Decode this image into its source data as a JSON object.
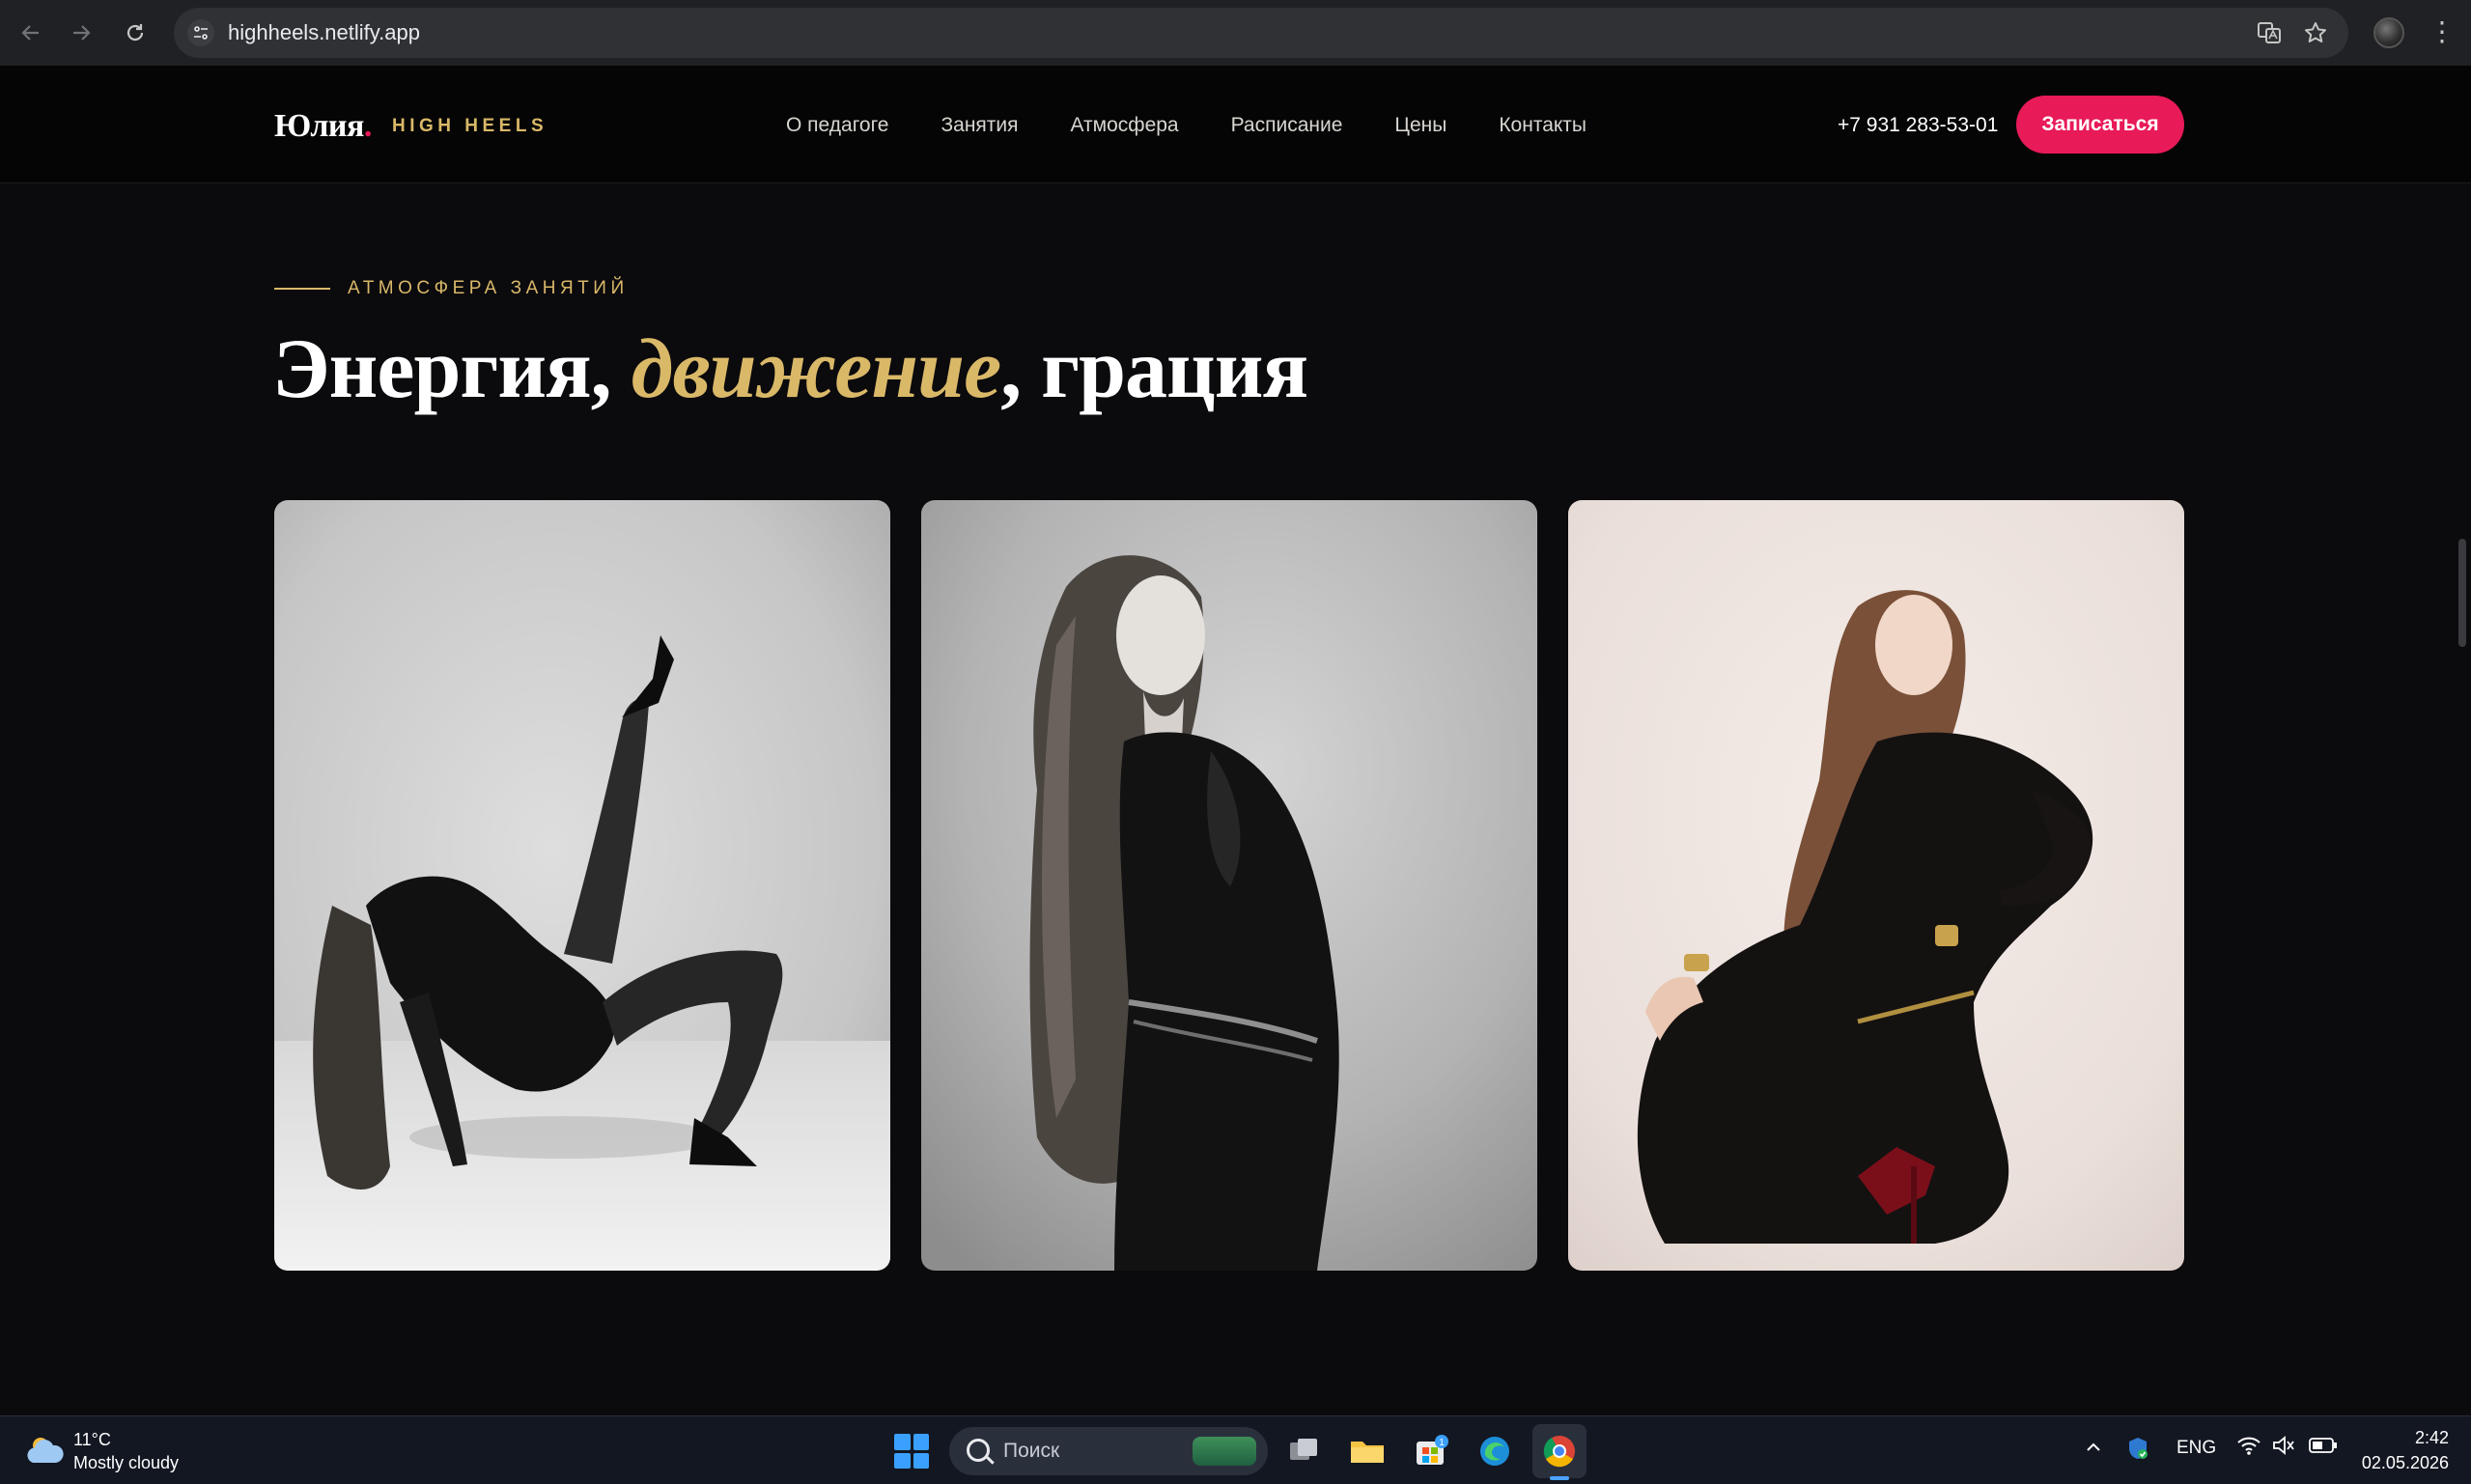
{
  "browser": {
    "url": "highheels.netlify.app",
    "icons": [
      "back-arrow-icon",
      "forward-arrow-icon",
      "reload-icon",
      "site-settings-icon",
      "translate-icon",
      "bookmark-star-icon",
      "profile-avatar",
      "menu-kebab-icon"
    ]
  },
  "header": {
    "logo_name": "Юлия",
    "logo_dot": ".",
    "logo_tag": "HIGH HEELS",
    "menu": [
      "О педагоге",
      "Занятия",
      "Атмосфера",
      "Расписание",
      "Цены",
      "Контакты"
    ],
    "phone": "+7 931 283-53-01",
    "cta_label": "Записаться",
    "accent_color": "#e81a58",
    "gold_color": "#d9b868"
  },
  "section": {
    "eyebrow": "АТМОСФЕРА ЗАНЯТИЙ",
    "headline_part1": "Энергия,",
    "headline_accent": "движение",
    "headline_part2": ", грация",
    "photos": [
      "dancer-pose-photo-1",
      "dancer-portrait-photo-2",
      "dancer-seated-photo-3"
    ]
  },
  "taskbar": {
    "weather_temp": "11°C",
    "weather_desc": "Mostly cloudy",
    "search_placeholder": "Поиск",
    "store_badge": "1",
    "language": "ENG",
    "time": "2:42",
    "date": "02.05.2026"
  }
}
